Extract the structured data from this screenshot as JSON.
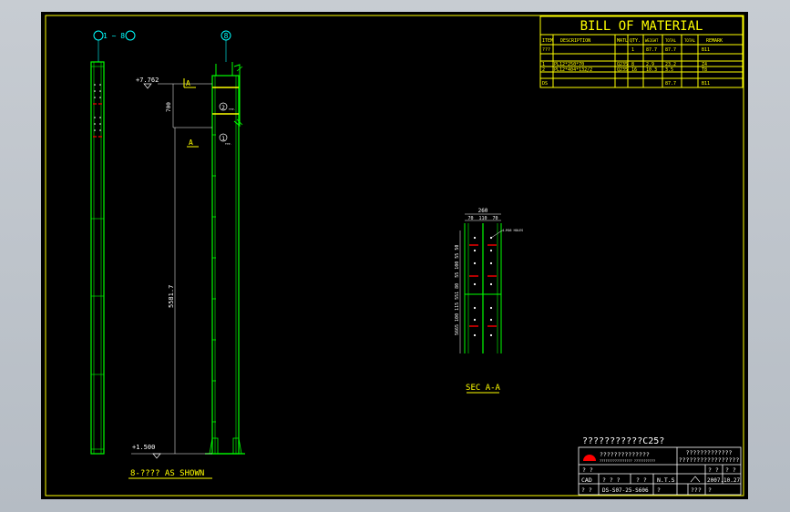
{
  "colors": {
    "bg": "#000000",
    "frame": "#ffff00",
    "green": "#00ff00",
    "cyan": "#00ffff",
    "red": "#ff0000",
    "white": "#ffffff"
  },
  "bom": {
    "title": "BILL OF MATERIAL",
    "headers": [
      "ITEM",
      "DESCRIPTION",
      "MATL",
      "QTY.",
      "WEIGHT",
      "TOTAL",
      "TOTAL",
      "REMARK"
    ],
    "rows": [
      [
        "???",
        "",
        "",
        "1",
        "87.7",
        "87.7",
        "B11"
      ],
      [
        "1",
        "PL12*250*70",
        "Q235",
        "8",
        "2.9",
        "23.2",
        "Z4"
      ],
      [
        "2",
        "PL12*404*132/2",
        "Q235",
        "16",
        "10.3",
        "3.5",
        "T8"
      ],
      [
        "DS",
        "",
        "",
        "",
        "",
        "87.7",
        "B11"
      ]
    ]
  },
  "elevation": {
    "col_range_label": "1 ~ 8",
    "col_label": "8",
    "top_level": "+7.762",
    "bottom_level": "+1.500",
    "dim_700": "700",
    "dim_height": "5581.7",
    "sec_mark": "A",
    "bubble_2": "2",
    "bubble_2_sub": "TYP.",
    "bubble_1": "1",
    "bubble_1_sub": "TYP.",
    "caption": "8-???? AS SHOWN"
  },
  "section": {
    "width_dim": "260",
    "sub_dims": "70  110  70",
    "hole_note": "4-M16 HOLES",
    "vertical_dims": "5665 100 115 551 80  55 100 55 50",
    "caption": "SEC A-A"
  },
  "title_block": {
    "project": "???????????C25?",
    "company": "??????????????",
    "company_small": "????????????????? ???????????",
    "drawing_title": "?????????????",
    "drawing_title2": "?????????????????",
    "cell1": "? ?",
    "cell2": "? ?",
    "cell3": "? ?",
    "cad": "CAD",
    "cad_val": "? ? ?",
    "cad_q": "? ?",
    "scale": "N.T.S",
    "date": "2007.10.27",
    "q1": "? ?",
    "dwg_no": "DS-S07-25-S606",
    "q2": "?",
    "q3": "???",
    "q4": "?"
  }
}
